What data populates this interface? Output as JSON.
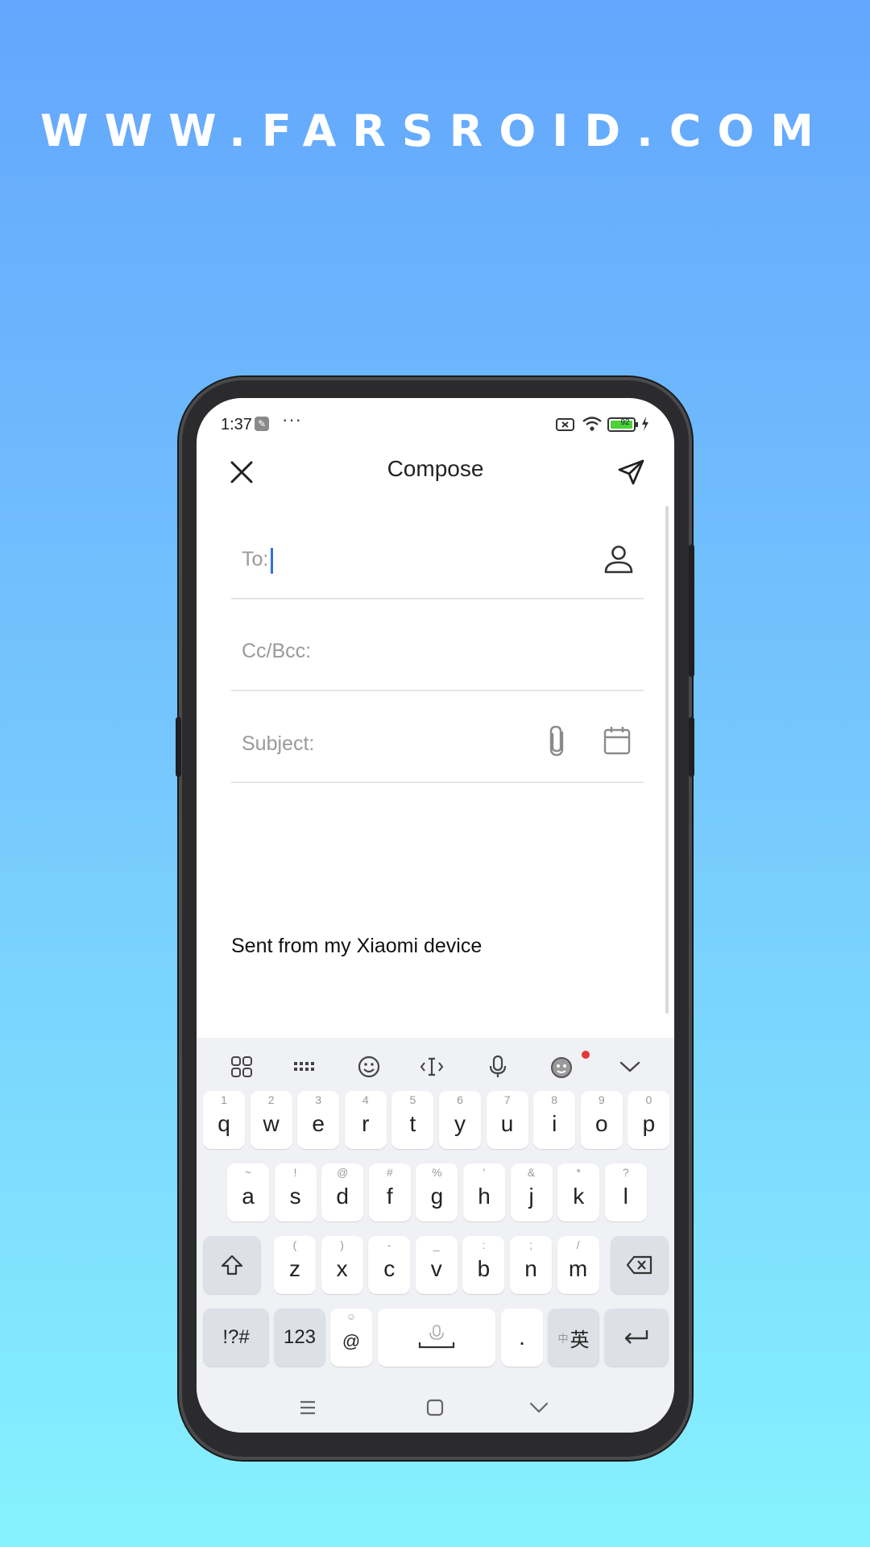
{
  "banner": {
    "text": "WWW.FARSROID.COM"
  },
  "status_bar": {
    "time": "1:37",
    "more": "···",
    "battery": "92"
  },
  "compose": {
    "title": "Compose",
    "to_label": "To:",
    "ccbcc_label": "Cc/Bcc:",
    "subject_label": "Subject:",
    "signature": "Sent from my Xiaomi device"
  },
  "keyboard": {
    "row1": [
      {
        "hint": "1",
        "key": "q"
      },
      {
        "hint": "2",
        "key": "w"
      },
      {
        "hint": "3",
        "key": "e"
      },
      {
        "hint": "4",
        "key": "r"
      },
      {
        "hint": "5",
        "key": "t"
      },
      {
        "hint": "6",
        "key": "y"
      },
      {
        "hint": "7",
        "key": "u"
      },
      {
        "hint": "8",
        "key": "i"
      },
      {
        "hint": "9",
        "key": "o"
      },
      {
        "hint": "0",
        "key": "p"
      }
    ],
    "row2": [
      {
        "hint": "~",
        "key": "a"
      },
      {
        "hint": "!",
        "key": "s"
      },
      {
        "hint": "@",
        "key": "d"
      },
      {
        "hint": "#",
        "key": "f"
      },
      {
        "hint": "%",
        "key": "g"
      },
      {
        "hint": "'",
        "key": "h"
      },
      {
        "hint": "&",
        "key": "j"
      },
      {
        "hint": "*",
        "key": "k"
      },
      {
        "hint": "?",
        "key": "l"
      }
    ],
    "row3": [
      {
        "hint": "(",
        "key": "z"
      },
      {
        "hint": ")",
        "key": "x"
      },
      {
        "hint": "-",
        "key": "c"
      },
      {
        "hint": "_",
        "key": "v"
      },
      {
        "hint": ":",
        "key": "b"
      },
      {
        "hint": ";",
        "key": "n"
      },
      {
        "hint": "/",
        "key": "m"
      }
    ],
    "symbols_label": "!?#",
    "numbers_label": "123",
    "at_key": "@",
    "period_key": ".",
    "lang_small": "中",
    "lang_main": "英"
  },
  "colors": {
    "accent": "#2f6fe0",
    "notification_dot": "#e53935"
  }
}
